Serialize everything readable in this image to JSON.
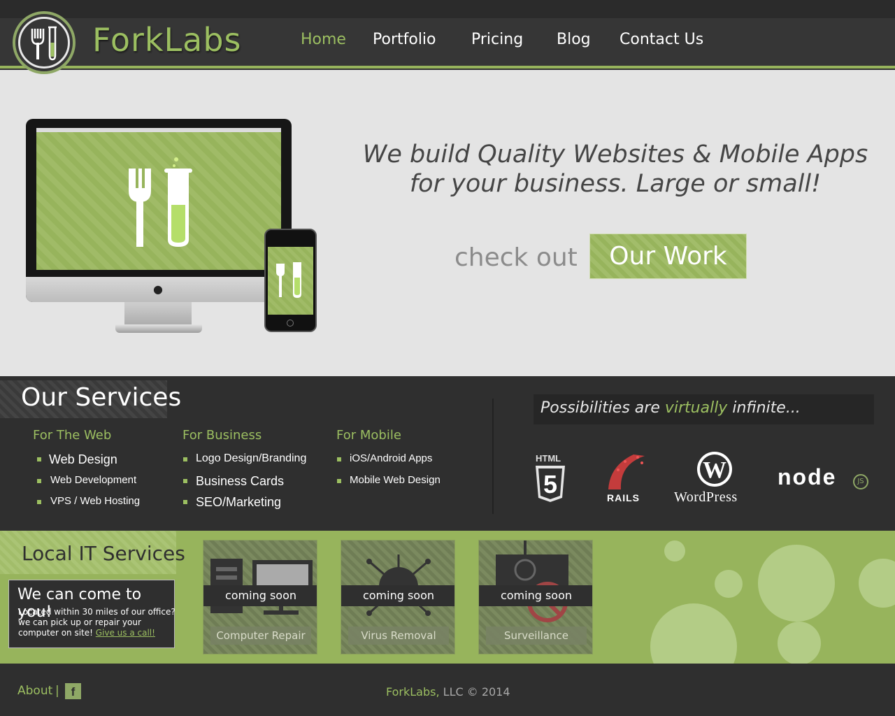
{
  "brand": {
    "name": "ForkLabs"
  },
  "nav": [
    {
      "label": "Home"
    },
    {
      "label": "Portfolio"
    },
    {
      "label": "Pricing"
    },
    {
      "label": "Blog"
    },
    {
      "label": "Contact Us"
    }
  ],
  "hero": {
    "tagline_line1": "We build Quality Websites & Mobile Apps",
    "tagline_line2": "for your business. Large or small!",
    "checkout": "check out",
    "cta": "Our Work"
  },
  "services": {
    "title": "Our Services",
    "columns": [
      {
        "heading": "For The Web",
        "items": [
          "Web Design",
          "Web Development",
          "VPS / Web Hosting"
        ]
      },
      {
        "heading": "For Business",
        "items": [
          "Logo Design/Branding",
          "Business Cards",
          "SEO/Marketing"
        ]
      },
      {
        "heading": "For Mobile",
        "items": [
          "iOS/Android Apps",
          "Mobile Web Design"
        ]
      }
    ],
    "possibilities": {
      "pre": "Possibilities are ",
      "highlight": "virtually",
      "post": " infinite..."
    },
    "tech_logos": {
      "html5_top": "HTML",
      "html5_num": "5",
      "rails": "RAILS",
      "wordpress": "WordPress",
      "node": "node",
      "node_js": "JS"
    }
  },
  "local": {
    "title": "Local IT Services",
    "box_title": "We can come to you!",
    "box_text": "Located within 30 miles of our office? we can pick up or repair your computer on site! ",
    "box_link": "Give us a call!",
    "tiles": [
      {
        "band": "coming soon",
        "label": "Computer Repair"
      },
      {
        "band": "coming soon",
        "label": "Virus Removal"
      },
      {
        "band": "coming soon",
        "label": "Surveillance"
      }
    ]
  },
  "footer": {
    "about": "About",
    "pipe": "|",
    "fb": "f",
    "company": "ForkLabs,",
    "copyright": " LLC © 2014"
  },
  "colors": {
    "accent": "#97b45c",
    "dark": "#2f2f2f",
    "hero_bg": "#e4e4e4"
  }
}
